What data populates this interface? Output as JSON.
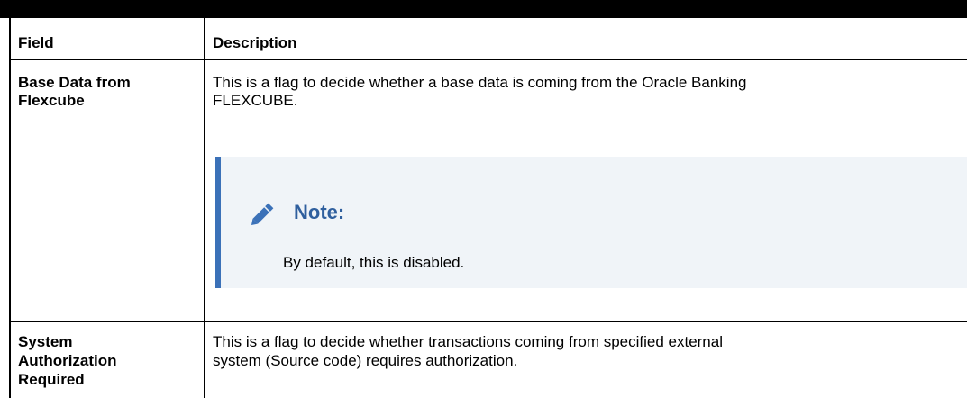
{
  "table": {
    "headers": {
      "field": "Field",
      "description": "Description"
    },
    "rows": [
      {
        "field_line1": "Base Data from",
        "field_line2": "Flexcube",
        "desc_line1": "This is a flag to decide whether a base data is coming from the Oracle Banking",
        "desc_line2": "FLEXCUBE.",
        "note": {
          "icon": "pencil-icon",
          "title": "Note:",
          "text": "By default, this is disabled."
        }
      },
      {
        "field_line1": "System",
        "field_line2": "Authorization",
        "field_line3": "Required",
        "desc_line1": "This is a flag to decide whether transactions coming from specified external",
        "desc_line2": "system (Source code) requires authorization."
      }
    ]
  },
  "colors": {
    "note_accent": "#3b71b8",
    "note_bg": "#f0f4f8",
    "note_title": "#2f5f9e"
  }
}
